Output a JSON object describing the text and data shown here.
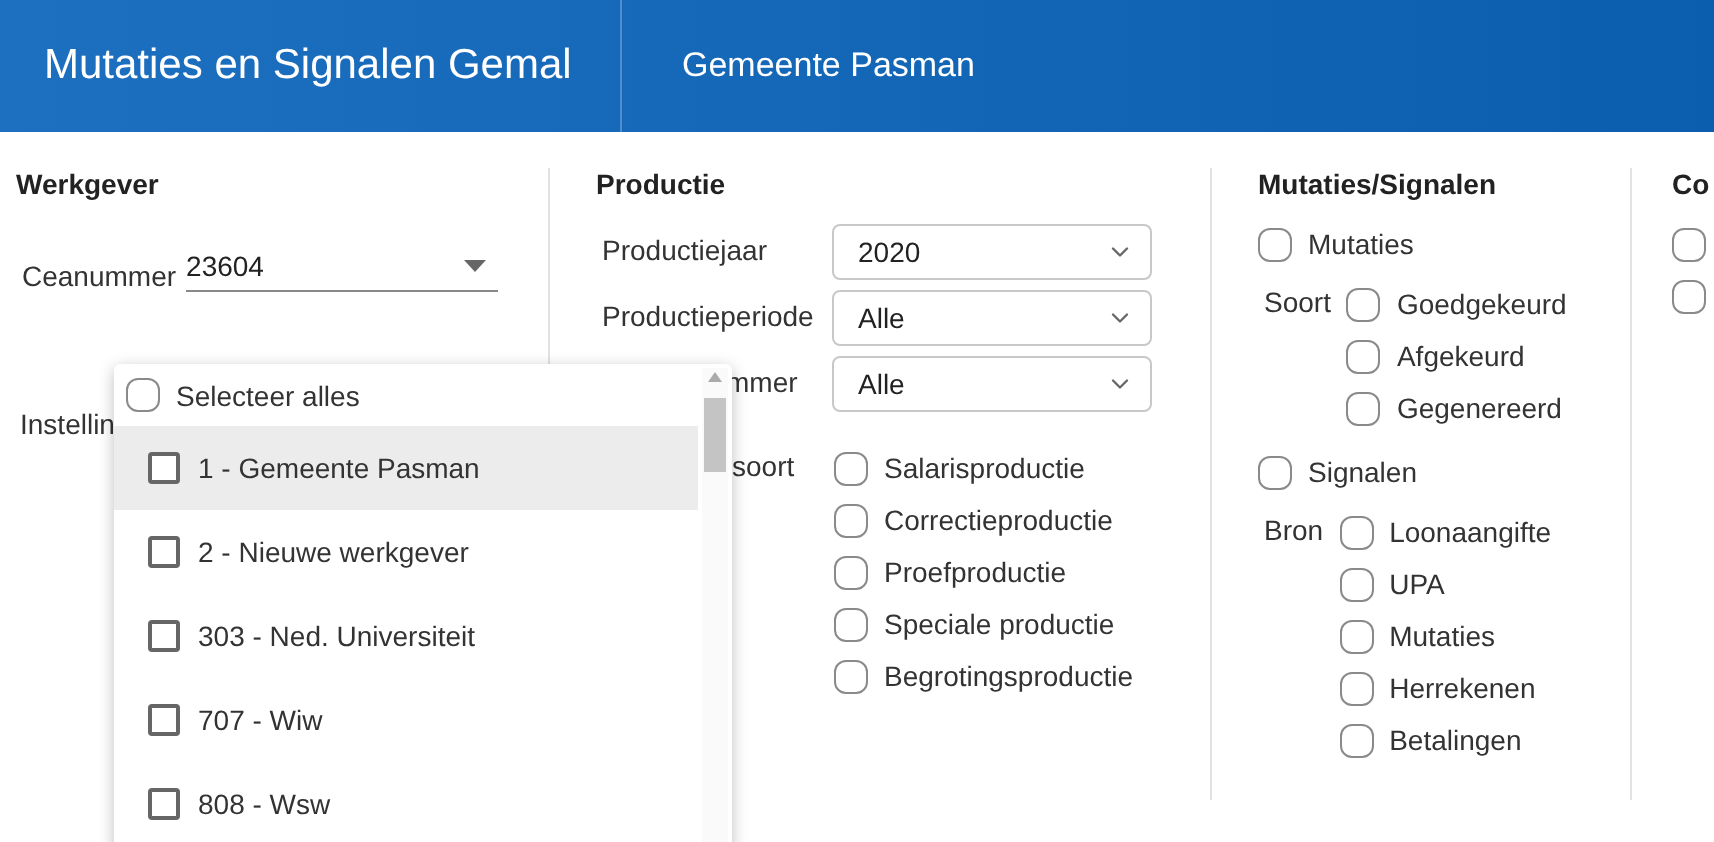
{
  "header": {
    "title": "Mutaties en Signalen Gemal",
    "subtitle": "Gemeente Pasman"
  },
  "werkgever": {
    "title": "Werkgever",
    "fields": [
      {
        "kind": "select",
        "label": "Ceanummer",
        "value": "23604"
      },
      {
        "kind": "label",
        "label": "Instellin"
      }
    ]
  },
  "productie": {
    "title": "Productie",
    "fields": [
      {
        "label": "Productiejaar",
        "value": "2020",
        "cut": false
      },
      {
        "label": "Productieperiode",
        "value": "Alle",
        "cut": false
      },
      {
        "label": "mmer",
        "value": "Alle",
        "cut": true
      }
    ],
    "soort_label": "soort",
    "options": [
      {
        "label": "Salarisproductie",
        "checked": false
      },
      {
        "label": "Correctieproductie",
        "checked": false
      },
      {
        "label": "Proefproductie",
        "checked": false
      },
      {
        "label": "Speciale productie",
        "checked": false
      },
      {
        "label": "Begrotingsproductie",
        "checked": false
      }
    ]
  },
  "mutaties_signalen": {
    "title": "Mutaties/Signalen",
    "groups": [
      {
        "label": "Mutaties",
        "checked": false,
        "sub_label": "Soort",
        "options": [
          {
            "label": "Goedgekeurd",
            "checked": false
          },
          {
            "label": "Afgekeurd",
            "checked": false
          },
          {
            "label": "Gegenereerd",
            "checked": false
          }
        ]
      },
      {
        "label": "Signalen",
        "checked": false,
        "sub_label": "Bron",
        "options": [
          {
            "label": "Loonaangifte",
            "checked": false
          },
          {
            "label": "UPA",
            "checked": false
          },
          {
            "label": "Mutaties",
            "checked": false
          },
          {
            "label": "Herrekenen",
            "checked": false
          },
          {
            "label": "Betalingen",
            "checked": false
          }
        ]
      }
    ]
  },
  "column_4": {
    "title": "Co",
    "checkboxes": [
      {
        "checked": false
      },
      {
        "checked": false
      }
    ]
  },
  "dropdown": {
    "select_all": {
      "label": "Selecteer alles",
      "checked": false
    },
    "items": [
      {
        "label": "1 - Gemeente Pasman",
        "checked": false,
        "highlighted": true
      },
      {
        "label": "2 - Nieuwe werkgever",
        "checked": false,
        "highlighted": false
      },
      {
        "label": "303 - Ned. Universiteit",
        "checked": false,
        "highlighted": false
      },
      {
        "label": "707 - Wiw",
        "checked": false,
        "highlighted": false
      },
      {
        "label": "808 - Wsw",
        "checked": false,
        "highlighted": false
      }
    ]
  }
}
